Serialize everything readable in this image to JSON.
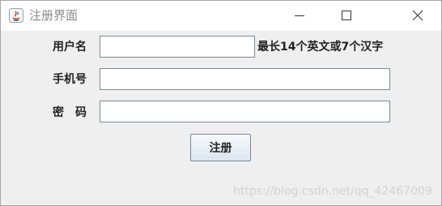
{
  "window": {
    "title": "注册界面",
    "controls": {
      "minimize_icon": "minimize-icon",
      "maximize_icon": "maximize-icon",
      "close_icon": "close-icon"
    }
  },
  "form": {
    "username_label": "用户名",
    "username_value": "",
    "username_hint": "最长14个英文或7个汉字",
    "phone_label": "手机号",
    "phone_value": "",
    "password_label": "密　码",
    "password_value": ""
  },
  "register_button_label": "注册",
  "watermark": "https://blog.csdn.net/qq_42467009",
  "colors": {
    "background": "#efefef",
    "titlebar": "#ffffff",
    "field_border": "#7a8a9a"
  }
}
